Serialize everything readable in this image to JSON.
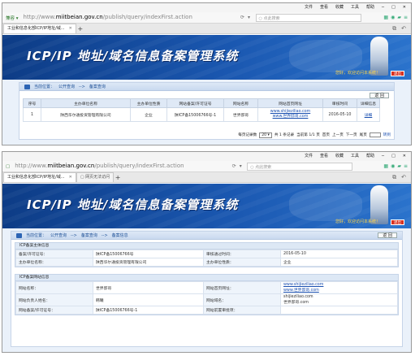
{
  "menu": [
    "文件",
    "查看",
    "收藏",
    "工具",
    "帮助"
  ],
  "browser": {
    "mode": "兼容 ▾",
    "url_prefix": "http://www.",
    "url_domain": "miitbeian.gov.cn",
    "url_path1": "/publish/query/indexFirst.action",
    "url_path2": "/publish/query/indexFirst.action",
    "search_placeholder": "点此搜索",
    "tab_title": "工业和信息化部ICP/IP地址/域...",
    "tab_title2": "工业和信息化部ICP/IP地址/域...",
    "tab2_inactive": "网页无法访问"
  },
  "site": {
    "title": "ICP/IP 地址/域名信息备案管理系统",
    "welcome": "您好，欢迎访问本系统！",
    "logout": "退出"
  },
  "list_page": {
    "breadcrumb": [
      "当前位置：",
      "公开查询",
      "-->",
      "备案查询"
    ],
    "back_button": "返 回",
    "headers": [
      "序号",
      "主办单位名称",
      "主办单位性质",
      "网站备案/许可证号",
      "网站名称",
      "网站首页网址",
      "审核时间",
      "详细信息"
    ],
    "rows": [
      {
        "no": "1",
        "org_name": "陕西华尔通投资管理有限公司",
        "org_type": "企业",
        "license": "陕ICP备15006766号-1",
        "site_name": "世界邸哥",
        "urls": [
          "www.shijieziliao.com",
          "www.世界邸哥.com"
        ],
        "review_date": "2016-05-10",
        "detail": "详细"
      }
    ],
    "pager": {
      "per_page_label": "每页记录数",
      "per_page": "20 ▾",
      "total": "共 1 条记录",
      "page": "当前第 1/1 页",
      "first": "首页",
      "prev": "上一页",
      "next": "下一页",
      "last": "尾页",
      "go": "转到"
    }
  },
  "detail_page": {
    "breadcrumb": [
      "当前位置：",
      "公开查询",
      "-->",
      "备案查询",
      "-->",
      "备案信息"
    ],
    "back_button": "返 回",
    "sec1_title": "ICP备案主体信息",
    "sec1": [
      {
        "k1": "备案/许可证号：",
        "v1": "陕ICP备15006766号",
        "k2": "审核通过时间：",
        "v2": "2016-05-10"
      },
      {
        "k1": "主办单位名称：",
        "v1": "陕西华尔通投资管理有限公司",
        "k2": "主办单位性质：",
        "v2": "企业"
      }
    ],
    "sec2_title": "ICP备案网站信息",
    "sec2": [
      {
        "k1": "网站名称：",
        "v1": "世界邸哥",
        "k2": "网站首页网址：",
        "v2a": "www.shijieziliao.com",
        "v2b": "www.世界邸哥.com"
      },
      {
        "k1": "网站负责人姓名：",
        "v1": "韩曦",
        "k2": "网站域名：",
        "v2a": "shijieziliao.com",
        "v2b": "世界邸哥.com"
      },
      {
        "k1": "网站备案/许可证号：",
        "v1": "陕ICP备15006766号-1",
        "k2": "网站前置审批项：",
        "v2a": "",
        "v2b": ""
      }
    ]
  }
}
